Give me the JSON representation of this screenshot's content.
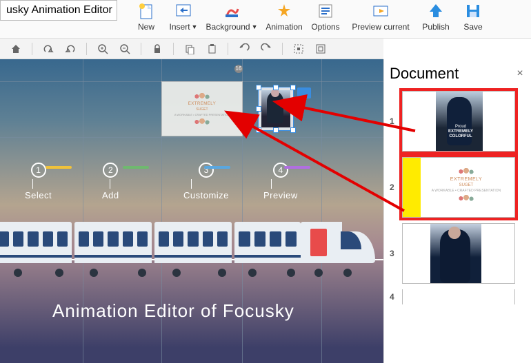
{
  "app_title": "usky Animation Editor",
  "ribbon": {
    "new": "New",
    "insert": "Insert",
    "background": "Background",
    "animation": "Animation",
    "options": "Options",
    "preview_current": "Preview current",
    "publish": "Publish",
    "save": "Save"
  },
  "canvas": {
    "rot_label": "16",
    "obj_white": {
      "line1": "EXTREMELY",
      "line2": "SUGET",
      "line3": "A WORKABLE • CRAFTED PRESENTATION"
    },
    "steps": [
      {
        "num": "1",
        "label": "Select",
        "bar_color": "#f0c23b"
      },
      {
        "num": "2",
        "label": "Add",
        "bar_color": "#6fb96f"
      },
      {
        "num": "3",
        "label": "Customize",
        "bar_color": "#5aa7e0"
      },
      {
        "num": "4",
        "label": "Preview",
        "bar_color": "#b06fe0"
      }
    ],
    "title_text": "Animation Editor of Focusky"
  },
  "doc_panel": {
    "title": "Document",
    "thumbs": [
      {
        "num": "1",
        "highlight": true,
        "t1": "Proud",
        "t2": "EXTREMELY",
        "t3": "COLORFUL"
      },
      {
        "num": "2",
        "highlight": true,
        "t1": "EXTREMELY",
        "t2": "SUGET",
        "t3": "A WORKABLE • CRAFTED PRESENTATION"
      },
      {
        "num": "3",
        "highlight": false
      },
      {
        "num": "4",
        "highlight": false
      }
    ]
  },
  "colors": {
    "accent": "#3a8de0",
    "highlight": "#e22"
  }
}
